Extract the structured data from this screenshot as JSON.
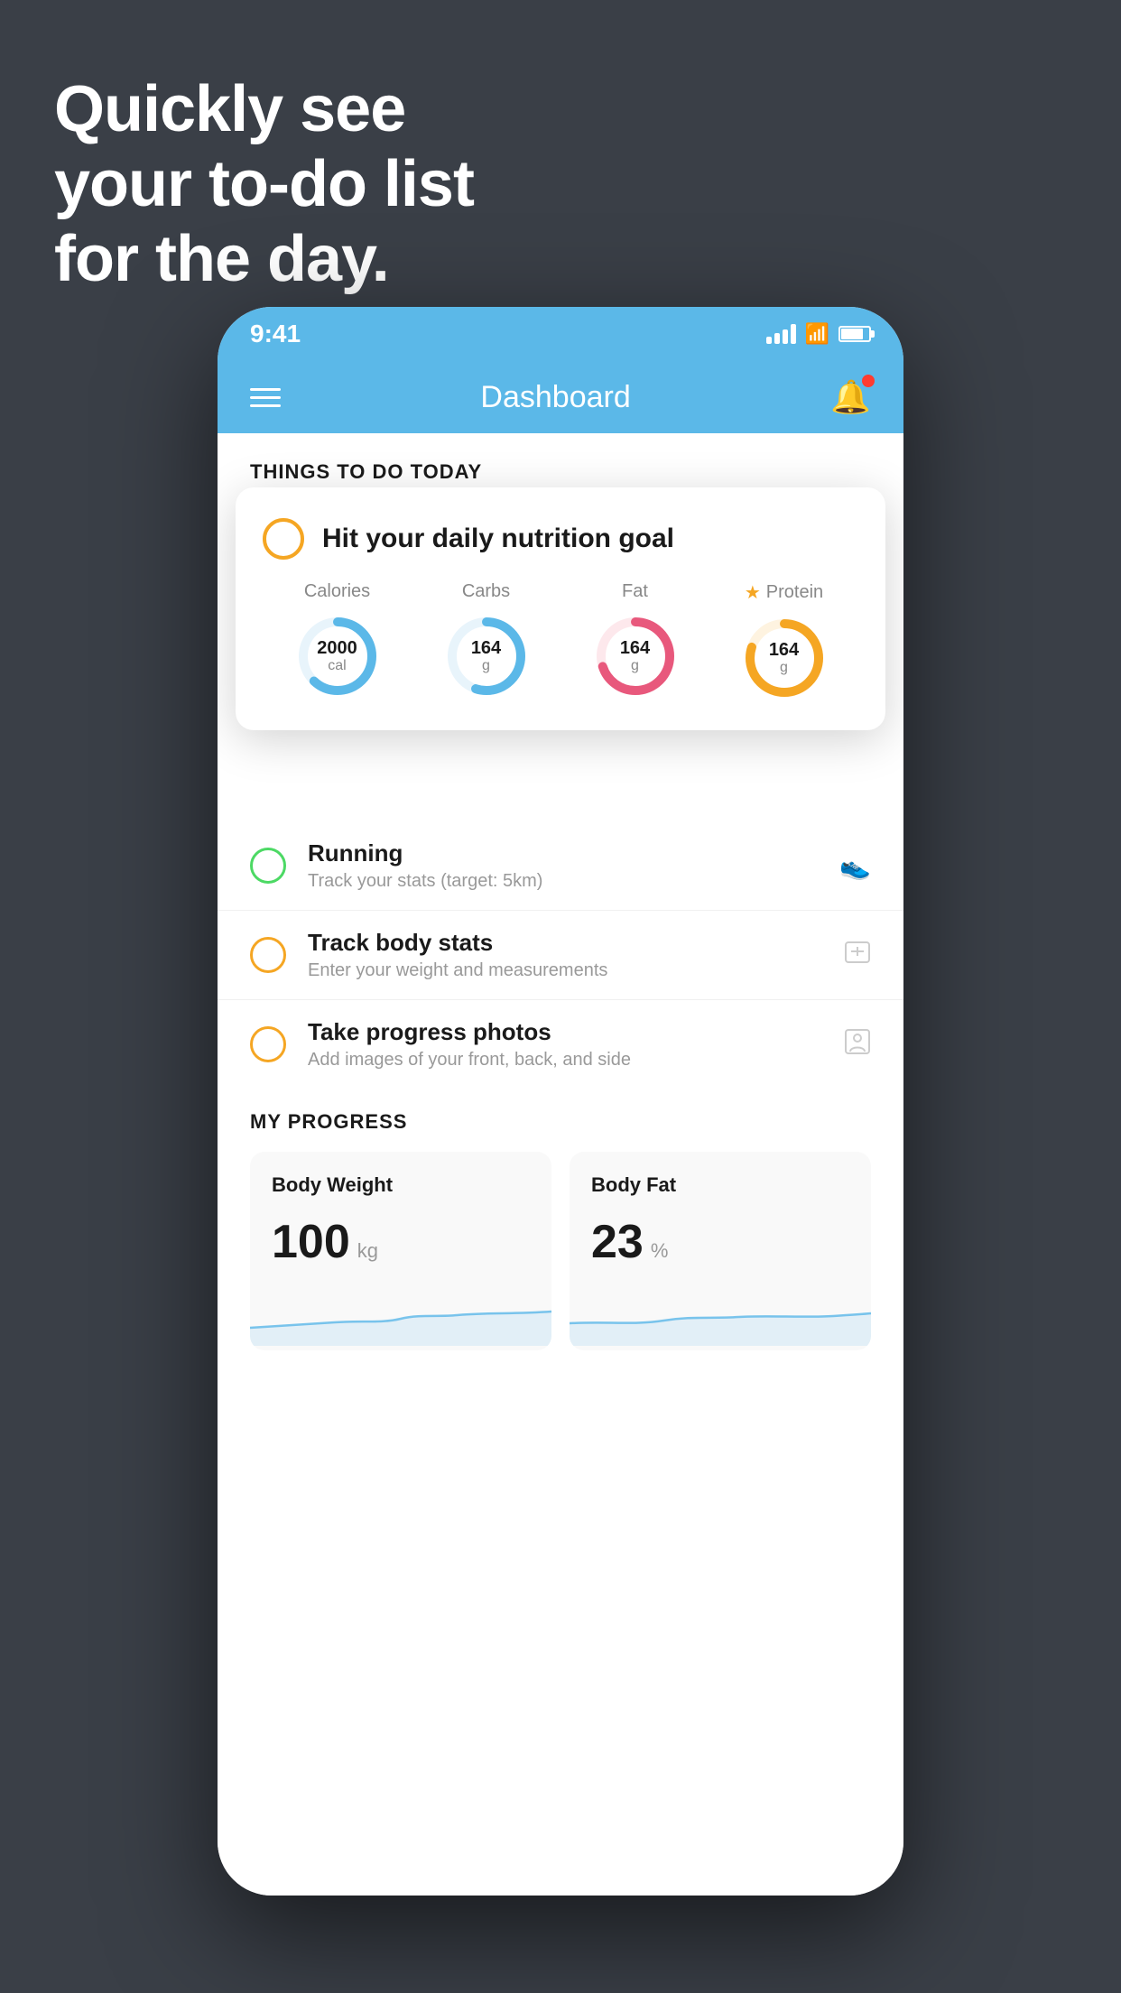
{
  "hero": {
    "line1": "Quickly see",
    "line2": "your to-do list",
    "line3": "for the day."
  },
  "statusBar": {
    "time": "9:41"
  },
  "navbar": {
    "title": "Dashboard"
  },
  "thingsToDoSection": {
    "header": "THINGS TO DO TODAY"
  },
  "nutritionCard": {
    "title": "Hit your daily nutrition goal",
    "items": [
      {
        "label": "Calories",
        "value": "2000",
        "unit": "cal",
        "color": "#5bb8e8",
        "pct": 62
      },
      {
        "label": "Carbs",
        "value": "164",
        "unit": "g",
        "color": "#5bb8e8",
        "pct": 55
      },
      {
        "label": "Fat",
        "value": "164",
        "unit": "g",
        "color": "#e8587c",
        "pct": 70
      },
      {
        "label": "Protein",
        "value": "164",
        "unit": "g",
        "color": "#f5a623",
        "pct": 80,
        "starred": true
      }
    ]
  },
  "todoItems": [
    {
      "title": "Running",
      "sub": "Track your stats (target: 5km)",
      "circleColor": "green",
      "icon": "shoe"
    },
    {
      "title": "Track body stats",
      "sub": "Enter your weight and measurements",
      "circleColor": "yellow",
      "icon": "scale"
    },
    {
      "title": "Take progress photos",
      "sub": "Add images of your front, back, and side",
      "circleColor": "yellow",
      "icon": "person"
    }
  ],
  "progressSection": {
    "header": "MY PROGRESS",
    "cards": [
      {
        "title": "Body Weight",
        "value": "100",
        "unit": "kg"
      },
      {
        "title": "Body Fat",
        "value": "23",
        "unit": "%"
      }
    ]
  }
}
